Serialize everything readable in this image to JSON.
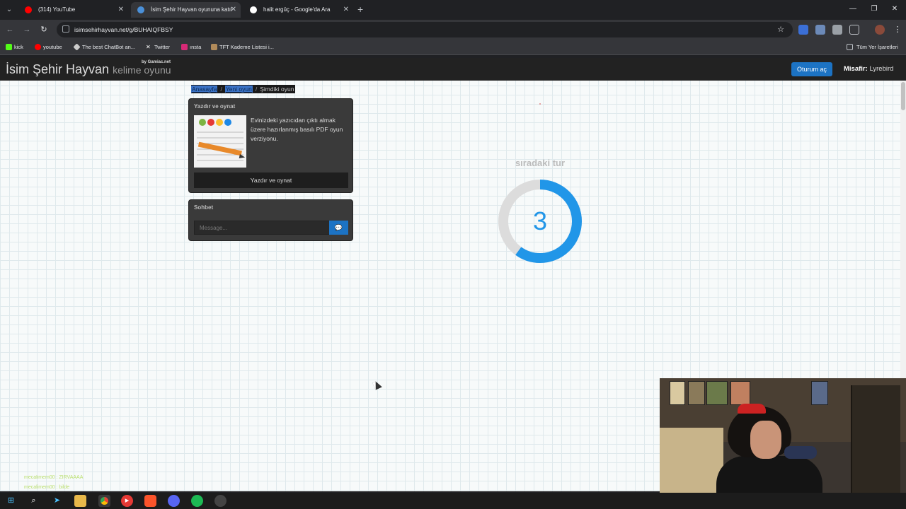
{
  "browser": {
    "tabs": [
      {
        "title": "(314) YouTube",
        "active": false,
        "icon": "youtube-icon",
        "color": "#ff0000"
      },
      {
        "title": "İsim Şehir Hayvan oyununa katıl",
        "active": true,
        "icon": "site-icon",
        "color": "#4a90d9"
      },
      {
        "title": "halit ergüç - Google'da Ara",
        "active": false,
        "icon": "google-icon",
        "color": "#ffffff"
      }
    ],
    "url": "isimsehirhayvan.net/g/BUHAIQFBSY",
    "bookmarks": [
      {
        "label": "kick",
        "color": "#53fc18"
      },
      {
        "label": "youtube",
        "color": "#ff0000"
      },
      {
        "label": "The best ChatBot an...",
        "color": "#cccccc"
      },
      {
        "label": "Twitter",
        "color": "#ffffff"
      },
      {
        "label": "ınsta",
        "color": "#d62976"
      },
      {
        "label": "TFT Kademe Listesi i...",
        "color": "#b08a5a"
      }
    ],
    "all_bookmarks": "Tüm Yer İşaretleri"
  },
  "site": {
    "brand": "İsim Şehir Hayvan",
    "brand_sub": "kelime oyunu",
    "brand_by": "by Gamiac.net",
    "login_label": "Oturum aç",
    "guest_prefix": "Misafir:",
    "guest_name": "Lyrebird"
  },
  "breadcrumb": {
    "home": "Anasayfa",
    "separator": "/",
    "new_game": "Yeni oyun",
    "current": "Şimdiki oyun"
  },
  "print_panel": {
    "title": "Yazdır ve oynat",
    "text": "Evinizdeki yazıcıdan çıktı almak üzere hazırlanmış basılı PDF oyun verziyonu.",
    "button": "Yazdır ve oynat"
  },
  "chat_panel": {
    "title": "Sohbet",
    "placeholder": "Message..."
  },
  "countdown": {
    "label": "sıradaki tur",
    "value": "3",
    "progress": 0.6,
    "colors": {
      "track": "#dcdcdc",
      "fill": "#2196e8"
    }
  },
  "stream_chat": [
    "mecalimem00 : ZIRVAAAA",
    "mecalimem00 : bilde"
  ],
  "taskbar": [
    "windows-icon",
    "search-icon",
    "terminal-icon",
    "files-icon",
    "chrome-icon",
    "media-icon",
    "brave-icon",
    "discord-icon",
    "spotify-icon",
    "obs-icon"
  ]
}
